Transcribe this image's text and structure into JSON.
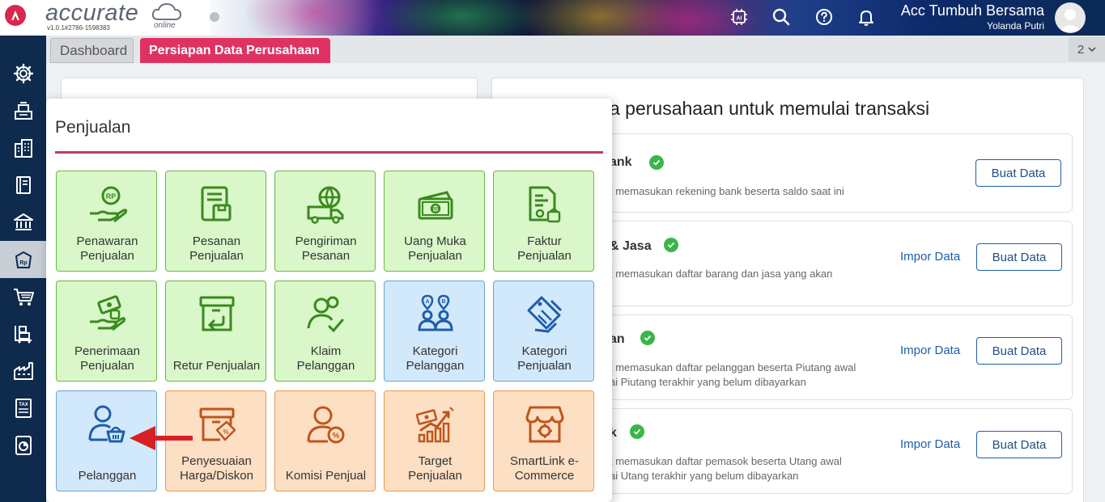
{
  "app": {
    "logo_text": "accurate",
    "logo_online": "online",
    "version": "v1.0.1#2786-1598383"
  },
  "header": {
    "company_name": "Acc Tumbuh Bersama",
    "user_name": "Yolanda Putri",
    "icons": [
      "ai-icon",
      "search-icon",
      "help-icon",
      "bell-icon"
    ]
  },
  "tabs": {
    "dashboard": "Dashboard",
    "persiapan": "Persiapan Data Perusahaan",
    "count": "2"
  },
  "main": {
    "title": "a perusahaan untuk memulai transaksi",
    "rows": [
      {
        "title": "ank",
        "desc1": "t memasukan rekening bank beserta saldo saat ini",
        "desc2": "",
        "impor": "",
        "buat": "Buat Data"
      },
      {
        "title": "& Jasa",
        "desc1": "t memasukan daftar barang dan jasa yang akan",
        "desc2": "",
        "impor": "Impor Data",
        "buat": "Buat Data"
      },
      {
        "title": "an",
        "desc1": "t memasukan daftar pelanggan beserta Piutang awal",
        "desc2": "ai Piutang terakhir yang belum dibayarkan",
        "impor": "Impor Data",
        "buat": "Buat Data"
      },
      {
        "title": "k",
        "desc1": "t memasukan daftar pemasok beserta Utang awal",
        "desc2": "ai Utang terakhir yang belum dibayarkan",
        "impor": "Impor Data",
        "buat": "Buat Data"
      }
    ]
  },
  "popup": {
    "title": "Penjualan",
    "tiles": [
      {
        "l1": "Penawaran",
        "l2": "Penjualan",
        "color": "green"
      },
      {
        "l1": "Pesanan",
        "l2": "Penjualan",
        "color": "green"
      },
      {
        "l1": "Pengiriman",
        "l2": "Pesanan",
        "color": "green"
      },
      {
        "l1": "Uang Muka",
        "l2": "Penjualan",
        "color": "green"
      },
      {
        "l1": "Faktur",
        "l2": "Penjualan",
        "color": "green"
      },
      {
        "l1": "Penerimaan",
        "l2": "Penjualan",
        "color": "green"
      },
      {
        "l1": "Retur Penjualan",
        "l2": "",
        "color": "green"
      },
      {
        "l1": "Klaim",
        "l2": "Pelanggan",
        "color": "green"
      },
      {
        "l1": "Kategori",
        "l2": "Pelanggan",
        "color": "blue"
      },
      {
        "l1": "Kategori",
        "l2": "Penjualan",
        "color": "blue"
      },
      {
        "l1": "Pelanggan",
        "l2": "",
        "color": "blue"
      },
      {
        "l1": "Penyesuaian",
        "l2": "Harga/Diskon",
        "color": "orange"
      },
      {
        "l1": "Komisi Penjual",
        "l2": "",
        "color": "orange"
      },
      {
        "l1": "Target",
        "l2": "Penjualan",
        "color": "orange"
      },
      {
        "l1": "SmartLink e-",
        "l2": "Commerce",
        "color": "orange"
      }
    ]
  },
  "colors": {
    "accent": "#e03262",
    "sidebar": "#0e2a4d",
    "green_icon": "#3a8a1e",
    "blue_icon": "#1f5ea8",
    "orange_icon": "#c0551c",
    "arrow": "#d81f26"
  }
}
